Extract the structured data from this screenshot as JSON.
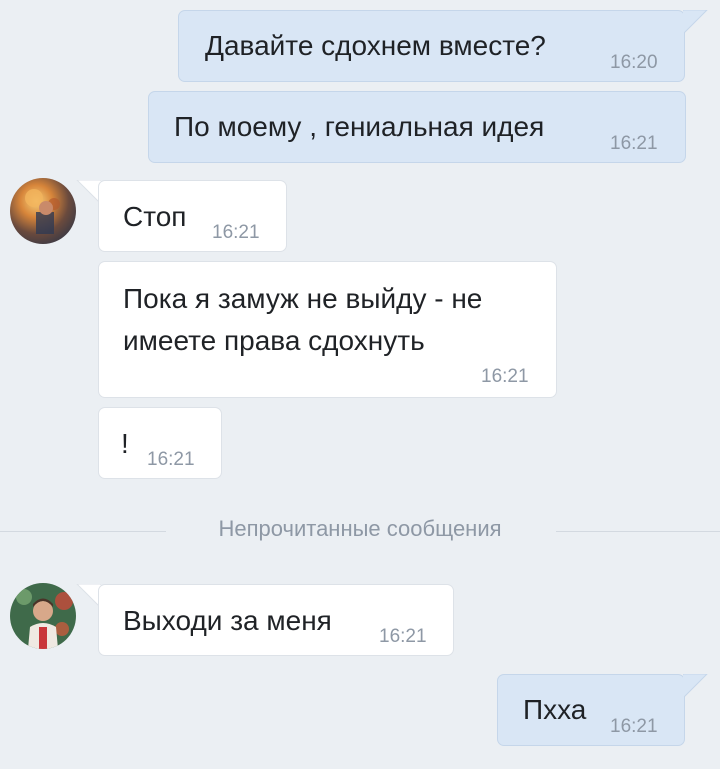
{
  "colors": {
    "background": "#ebeff3",
    "outgoing_bubble": "#d9e6f5",
    "incoming_bubble": "#ffffff",
    "timestamp": "#8e98a5",
    "text": "#1f2226"
  },
  "messages": [
    {
      "direction": "outgoing",
      "text": "Давайте сдохнем вместе?",
      "time": "16:20"
    },
    {
      "direction": "outgoing",
      "text": "По моему , гениальная идея",
      "time": "16:21"
    },
    {
      "direction": "incoming",
      "text": "Стоп",
      "time": "16:21",
      "avatar": "avatar-fire-photo"
    },
    {
      "direction": "incoming",
      "text_line1": "Пока я замуж не выйду - не",
      "text_line2": "имеете права сдохнуть",
      "time": "16:21"
    },
    {
      "direction": "incoming",
      "text": "!",
      "time": "16:21"
    },
    {
      "direction": "incoming",
      "text": "Выходи за меня",
      "time": "16:21",
      "avatar": "avatar-man-photo"
    },
    {
      "direction": "outgoing",
      "text": "Пхха",
      "time": "16:21"
    }
  ],
  "divider": {
    "label": "Непрочитанные сообщения"
  }
}
